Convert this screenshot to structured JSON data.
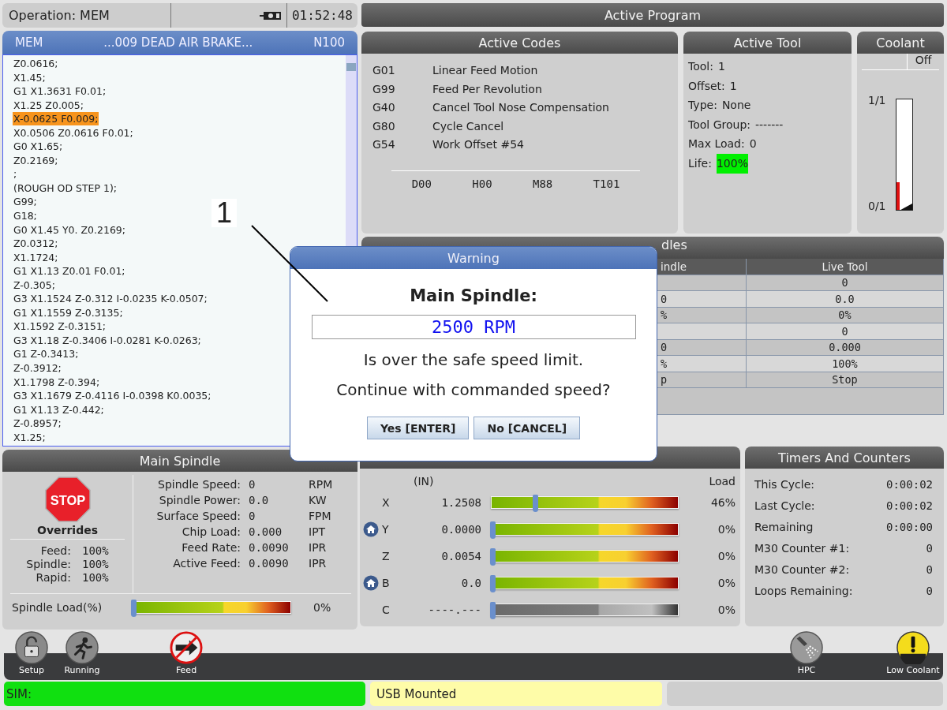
{
  "status_bar": {
    "operation": "Operation: MEM",
    "time": "01:52:48"
  },
  "program": {
    "mode": "MEM",
    "name": "...009 DEAD AIR BRAKE...",
    "block": "N100",
    "lines": [
      {
        "text": "Z0.0616;",
        "selected": false
      },
      {
        "text": "X1.45;",
        "selected": false
      },
      {
        "text": "G1 X1.3631 F0.01;",
        "selected": false
      },
      {
        "text": "X1.25 Z0.005;",
        "selected": false
      },
      {
        "text": "X-0.0625 F0.009;",
        "selected": true
      },
      {
        "text": "X0.0506 Z0.0616 F0.01;",
        "selected": false
      },
      {
        "text": "G0 X1.65;",
        "selected": false
      },
      {
        "text": "Z0.2169;",
        "selected": false
      },
      {
        "text": ";",
        "selected": false
      },
      {
        "text": "(ROUGH OD STEP 1);",
        "selected": false
      },
      {
        "text": "G99;",
        "selected": false
      },
      {
        "text": "G18;",
        "selected": false
      },
      {
        "text": "G0 X1.45 Y0. Z0.2169;",
        "selected": false
      },
      {
        "text": "Z0.0312;",
        "selected": false
      },
      {
        "text": "X1.1724;",
        "selected": false
      },
      {
        "text": "G1 X1.13 Z0.01 F0.01;",
        "selected": false
      },
      {
        "text": "Z-0.305;",
        "selected": false
      },
      {
        "text": "G3 X1.1524 Z-0.312 I-0.0235 K-0.0507;",
        "selected": false
      },
      {
        "text": "G1 X1.1559 Z-0.3135;",
        "selected": false
      },
      {
        "text": "X1.1592 Z-0.3151;",
        "selected": false
      },
      {
        "text": "G3 X1.18 Z-0.3406 I-0.0281 K-0.0263;",
        "selected": false
      },
      {
        "text": "G1 Z-0.3413;",
        "selected": false
      },
      {
        "text": "Z-0.3912;",
        "selected": false
      },
      {
        "text": "X1.1798 Z-0.394;",
        "selected": false
      },
      {
        "text": "G3 X1.1679 Z-0.4116 I-0.0398 K0.0035;",
        "selected": false
      },
      {
        "text": "G1 X1.13 Z-0.442;",
        "selected": false
      },
      {
        "text": "Z-0.8957;",
        "selected": false
      },
      {
        "text": "X1.25;",
        "selected": false
      }
    ]
  },
  "active_program": {
    "title": "Active Program"
  },
  "active_codes": {
    "title": "Active Codes",
    "codes": [
      {
        "code": "G01",
        "description": "Linear Feed Motion"
      },
      {
        "code": "G99",
        "description": "Feed Per Revolution"
      },
      {
        "code": "G40",
        "description": "Cancel Tool Nose Compensation"
      },
      {
        "code": "G80",
        "description": "Cycle Cancel"
      },
      {
        "code": "G54",
        "description": "Work Offset #54"
      }
    ],
    "footer": [
      "D00",
      "H00",
      "M88",
      "T101"
    ]
  },
  "active_tool": {
    "title": "Active Tool",
    "items": [
      {
        "label": "Tool:",
        "value": "1",
        "highlight": false
      },
      {
        "label": "Offset:",
        "value": "1",
        "highlight": false
      },
      {
        "label": "Type:",
        "value": "None",
        "highlight": false
      },
      {
        "label": "Tool Group:",
        "value": "-------",
        "highlight": false
      },
      {
        "label": "Max Load:",
        "value": "0",
        "highlight": false
      },
      {
        "label": "Life:",
        "value": "100%",
        "highlight": true
      }
    ]
  },
  "coolant": {
    "title": "Coolant",
    "state": "Off",
    "top_label": "1/1",
    "bottom_label": "0/1",
    "level": 0.25
  },
  "spindles": {
    "title": "dles",
    "column_1": "indle",
    "column_2": "Live Tool",
    "rows": [
      {
        "column_2": "0"
      },
      {
        "column_1": "0",
        "column_2": "0.0"
      },
      {
        "column_1": "%",
        "column_2": "0%"
      },
      {
        "column_2": "0"
      },
      {
        "column_1": "0",
        "column_2": "0.000"
      },
      {
        "column_1": "%",
        "column_2": "100%"
      },
      {
        "column_1": "p",
        "column_2": "Stop"
      }
    ]
  },
  "main_spindle": {
    "title": "Main Spindle",
    "stop_sign": "STOP",
    "overrides_title": "Overrides",
    "overrides": [
      {
        "label": "Feed:",
        "value": "100%"
      },
      {
        "label": "Spindle:",
        "value": "100%"
      },
      {
        "label": "Rapid:",
        "value": "100%"
      }
    ],
    "stats": [
      {
        "label": "Spindle Speed:",
        "value": "0",
        "unit": "RPM"
      },
      {
        "label": "Spindle Power:",
        "value": "0.0",
        "unit": "KW"
      },
      {
        "label": "Surface Speed:",
        "value": "0",
        "unit": "FPM"
      },
      {
        "label": "Chip Load:",
        "value": "0.000",
        "unit": "IPT"
      },
      {
        "label": "Feed Rate:",
        "value": "0.0090",
        "unit": "IPR"
      },
      {
        "label": "Active Feed:",
        "value": "0.0090",
        "unit": "IPR"
      }
    ],
    "load": {
      "label": "Spindle Load(%)",
      "level": 0,
      "reading": "0%"
    }
  },
  "positions": {
    "unit": "(IN)",
    "load_header": "Load",
    "axes": [
      {
        "axis": "X",
        "value": "1.2508",
        "level": 0.23,
        "reading": "46%",
        "homed": false,
        "disabled": false
      },
      {
        "axis": "Y",
        "value": "0.0000",
        "level": 0,
        "reading": "0%",
        "homed": true,
        "disabled": false
      },
      {
        "axis": "Z",
        "value": "0.0054",
        "level": 0,
        "reading": "0%",
        "homed": false,
        "disabled": false
      },
      {
        "axis": "B",
        "value": "0.0",
        "level": 0,
        "reading": "0%",
        "homed": true,
        "disabled": false
      },
      {
        "axis": "C",
        "value": "----.---",
        "level": 0,
        "reading": "0%",
        "homed": false,
        "disabled": true
      }
    ]
  },
  "timers": {
    "title": "Timers And Counters",
    "rows": [
      {
        "label": "This Cycle:",
        "value": "0:00:02"
      },
      {
        "label": "Last Cycle:",
        "value": "0:00:02"
      },
      {
        "label": "Remaining",
        "value": "0:00:00"
      },
      {
        "label": "M30 Counter #1:",
        "value": "0"
      },
      {
        "label": "M30 Counter #2:",
        "value": "0"
      },
      {
        "label": "Loops Remaining:",
        "value": "0"
      }
    ]
  },
  "icon_bar": [
    {
      "kind": "lock",
      "label": "Setup"
    },
    {
      "kind": "runner",
      "label": "Running"
    },
    {
      "kind": "nofeed",
      "label": "Feed"
    },
    {
      "kind": "spray",
      "label": "HPC"
    },
    {
      "kind": "warning",
      "label": "Low Coolant"
    }
  ],
  "messages": [
    {
      "kind": "sim",
      "text": "SIM:"
    },
    {
      "kind": "notice",
      "text": "USB Mounted"
    },
    {
      "kind": "empty"
    }
  ],
  "dialog": {
    "title": "Warning",
    "heading": "Main Spindle:",
    "value": "2500 RPM",
    "message": "Is over the safe speed limit.",
    "question": "Continue with commanded speed?",
    "buttons": [
      "Yes [ENTER]",
      "No [CANCEL]"
    ]
  },
  "callout": {
    "label": "1"
  }
}
